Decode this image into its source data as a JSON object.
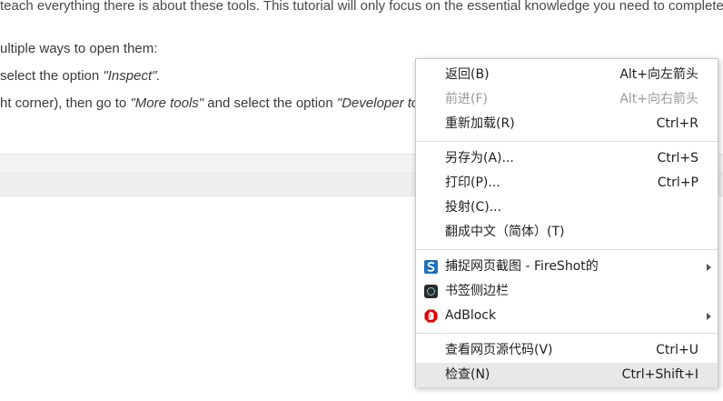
{
  "background": {
    "line1": "teach everything there is about these tools. This tutorial will only focus on the essential knowledge you need to complete ce",
    "line2": "ultiple ways to open them:",
    "line3_pre": "select the option ",
    "line3_em": "\"Inspect\".",
    "line4_pre": "ht corner), then go to ",
    "line4_em1": "\"More tools\"",
    "line4_mid": " and select the option ",
    "line4_em2": "\"Developer to"
  },
  "menu": {
    "back": {
      "label": "返回(B)",
      "shortcut": "Alt+向左箭头"
    },
    "forward": {
      "label": "前进(F)",
      "shortcut": "Alt+向右箭头"
    },
    "reload": {
      "label": "重新加载(R)",
      "shortcut": "Ctrl+R"
    },
    "save_as": {
      "label": "另存为(A)...",
      "shortcut": "Ctrl+S"
    },
    "print": {
      "label": "打印(P)...",
      "shortcut": "Ctrl+P"
    },
    "cast": {
      "label": "投射(C)..."
    },
    "translate": {
      "label": "翻成中文（简体）(T)"
    },
    "fireshot": {
      "label": "捕捉网页截图 - FireShot的"
    },
    "bookmark_sidebar": {
      "label": "书签侧边栏"
    },
    "adblock": {
      "label": "AdBlock"
    },
    "view_source": {
      "label": "查看网页源代码(V)",
      "shortcut": "Ctrl+U"
    },
    "inspect": {
      "label": "检查(N)",
      "shortcut": "Ctrl+Shift+I"
    }
  },
  "colors": {
    "fireshot": "#1d6fb7",
    "adblock": "#e00000",
    "highlight": "#e8e8e8"
  },
  "icons": {
    "fireshot": "fireshot-icon",
    "bookmark_sidebar": "bookmark-sidebar-icon",
    "adblock": "adblock-icon",
    "submenu": "chevron-right-icon"
  }
}
